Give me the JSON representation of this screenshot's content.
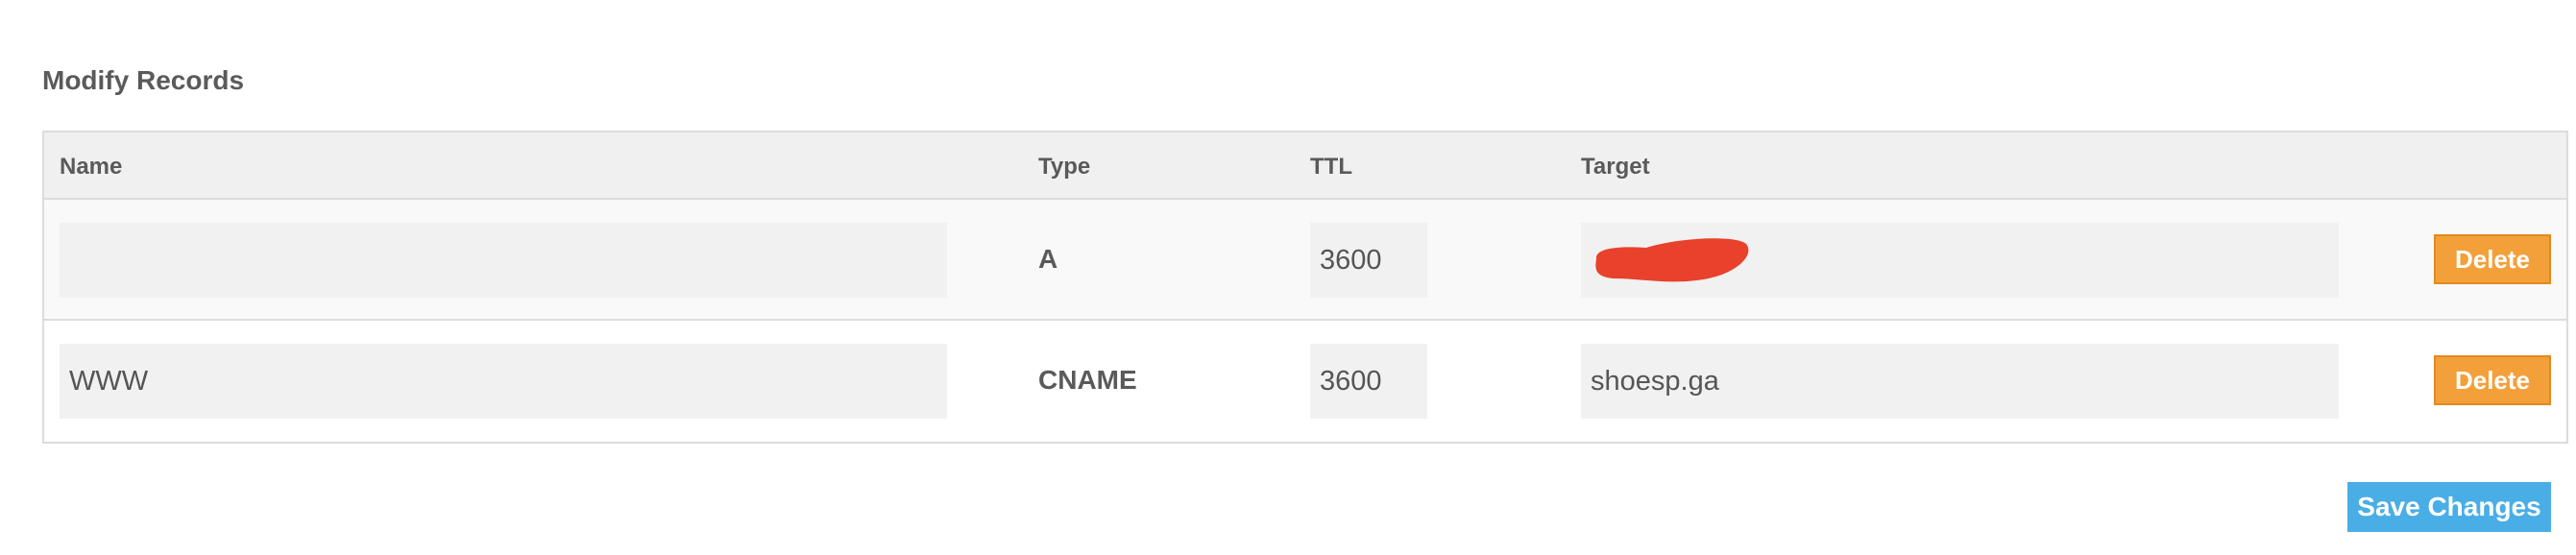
{
  "section": {
    "title": "Modify Records"
  },
  "table": {
    "headers": {
      "name": "Name",
      "type": "Type",
      "ttl": "TTL",
      "target": "Target"
    },
    "records": [
      {
        "name": "",
        "type": "A",
        "ttl": "3600",
        "target": "",
        "target_redacted": true,
        "delete_label": "Delete"
      },
      {
        "name": "WWW",
        "type": "CNAME",
        "ttl": "3600",
        "target": "shoesp.ga",
        "target_redacted": false,
        "delete_label": "Delete"
      }
    ]
  },
  "actions": {
    "save_label": "Save Changes"
  },
  "colors": {
    "delete_button": "#f4a03a",
    "save_button": "#4aaee6",
    "redaction_mark": "#e8412c"
  }
}
